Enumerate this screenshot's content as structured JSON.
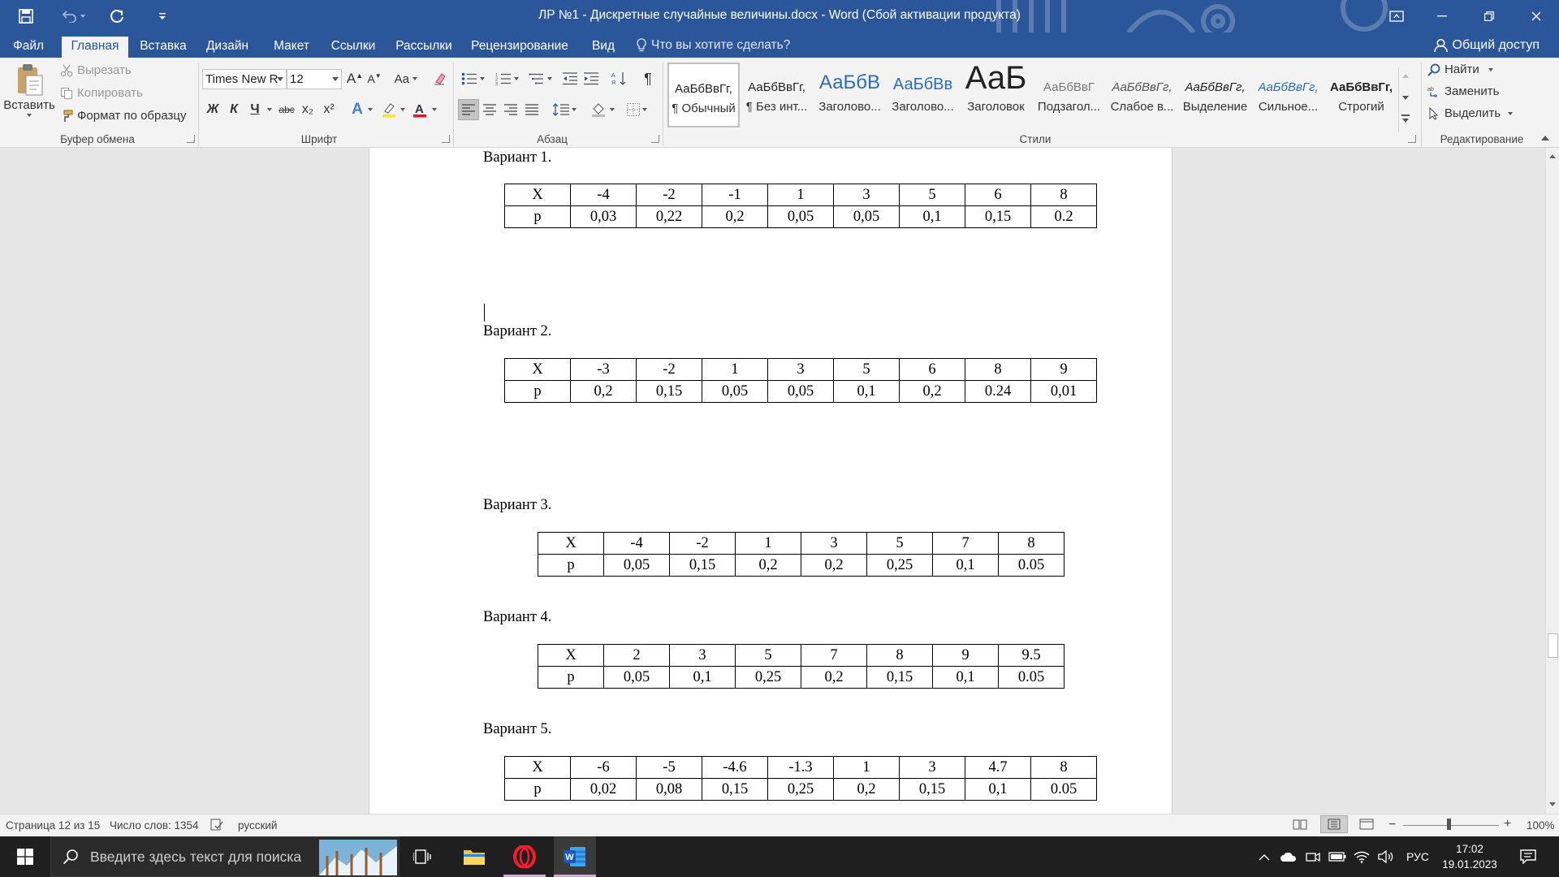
{
  "window": {
    "title": "ЛР №1 - Дискретные случайные величины.docx - Word (Сбой активации продукта)",
    "controls": {
      "ribbon_display": "ribbon-display-icon",
      "minimize": "minimize-icon",
      "restore": "restore-icon",
      "close": "close-icon"
    }
  },
  "quick_access": {
    "save": "save-icon",
    "undo": "undo-icon",
    "redo": "redo-icon",
    "customize": "customize-icon"
  },
  "tabs": [
    {
      "label": "Файл",
      "active": false
    },
    {
      "label": "Главная",
      "active": true
    },
    {
      "label": "Вставка",
      "active": false
    },
    {
      "label": "Дизайн",
      "active": false
    },
    {
      "label": "Макет",
      "active": false
    },
    {
      "label": "Ссылки",
      "active": false
    },
    {
      "label": "Рассылки",
      "active": false
    },
    {
      "label": "Рецензирование",
      "active": false
    },
    {
      "label": "Вид",
      "active": false
    }
  ],
  "tell_me": "Что вы хотите сделать?",
  "share": "Общий доступ",
  "clipboard": {
    "group_label": "Буфер обмена",
    "paste": "Вставить",
    "cut": "Вырезать",
    "copy": "Копировать",
    "format_painter": "Формат по образцу"
  },
  "font": {
    "group_label": "Шрифт",
    "family": "Times New R",
    "size": "12",
    "case_label": "Aa",
    "bold": "Ж",
    "italic": "К",
    "underline": "Ч",
    "strike": "abc",
    "sub": "x₂",
    "sup": "x²"
  },
  "paragraph": {
    "group_label": "Абзац"
  },
  "styles": {
    "group_label": "Стили",
    "items": [
      {
        "preview": "АаБбВвГг,",
        "name": "¶ Обычный",
        "selected": true
      },
      {
        "preview": "АаБбВвГг,",
        "name": "¶ Без инт..."
      },
      {
        "preview": "АаБбВ",
        "name": "Заголово..."
      },
      {
        "preview": "АаБбВв",
        "name": "Заголово..."
      },
      {
        "preview": "АаБ",
        "name": "Заголовок"
      },
      {
        "preview": "АаБбВвГ",
        "name": "Подзагол..."
      },
      {
        "preview": "АаБбВвГг,",
        "name": "Слабое в..."
      },
      {
        "preview": "АаБбВвГг,",
        "name": "Выделение"
      },
      {
        "preview": "АаБбВвГг,",
        "name": "Сильное..."
      },
      {
        "preview": "АаБбВвГг,",
        "name": "Строгий"
      }
    ]
  },
  "editing": {
    "group_label": "Редактирование",
    "find": "Найти",
    "replace": "Заменить",
    "select": "Выделить"
  },
  "document": {
    "variants": [
      {
        "title": "Вариант 1.",
        "header_x": "X",
        "header_p": "p",
        "x": [
          "-4",
          "-2",
          "-1",
          "1",
          "3",
          "5",
          "6",
          "8"
        ],
        "p": [
          "0,03",
          "0,22",
          "0,2",
          "0,05",
          "0,05",
          "0,1",
          "0,15",
          "0.2"
        ]
      },
      {
        "title": "Вариант 2.",
        "header_x": "X",
        "header_p": "p",
        "x": [
          "-3",
          "-2",
          "1",
          "3",
          "5",
          "6",
          "8",
          "9"
        ],
        "p": [
          "0,2",
          "0,15",
          "0,05",
          "0,05",
          "0,1",
          "0,2",
          "0.24",
          "0,01"
        ]
      },
      {
        "title": "Вариант 3.",
        "header_x": "X",
        "header_p": "p",
        "x": [
          "-4",
          "-2",
          "1",
          "3",
          "5",
          "7",
          "8"
        ],
        "p": [
          "0,05",
          "0,15",
          "0,2",
          "0,2",
          "0,25",
          "0,1",
          "0.05"
        ]
      },
      {
        "title": "Вариант 4.",
        "header_x": "X",
        "header_p": "p",
        "x": [
          "2",
          "3",
          "5",
          "7",
          "8",
          "9",
          "9.5"
        ],
        "p": [
          "0,05",
          "0,1",
          "0,25",
          "0,2",
          "0,15",
          "0,1",
          "0.05"
        ]
      },
      {
        "title": "Вариант 5.",
        "header_x": "X",
        "header_p": "p",
        "x": [
          "-6",
          "-5",
          "-4.6",
          "-1.3",
          "1",
          "3",
          "4.7",
          "8"
        ],
        "p": [
          "0,02",
          "0,08",
          "0,15",
          "0,25",
          "0,2",
          "0,15",
          "0,1",
          "0.05"
        ]
      }
    ]
  },
  "status": {
    "page": "Страница 12 из 15",
    "words": "Число слов: 1354",
    "language": "русский",
    "zoom": "100%"
  },
  "taskbar": {
    "search_placeholder": "Введите здесь текст для поиска",
    "lang": "РУС",
    "time": "17:02",
    "date": "19.01.2023"
  }
}
